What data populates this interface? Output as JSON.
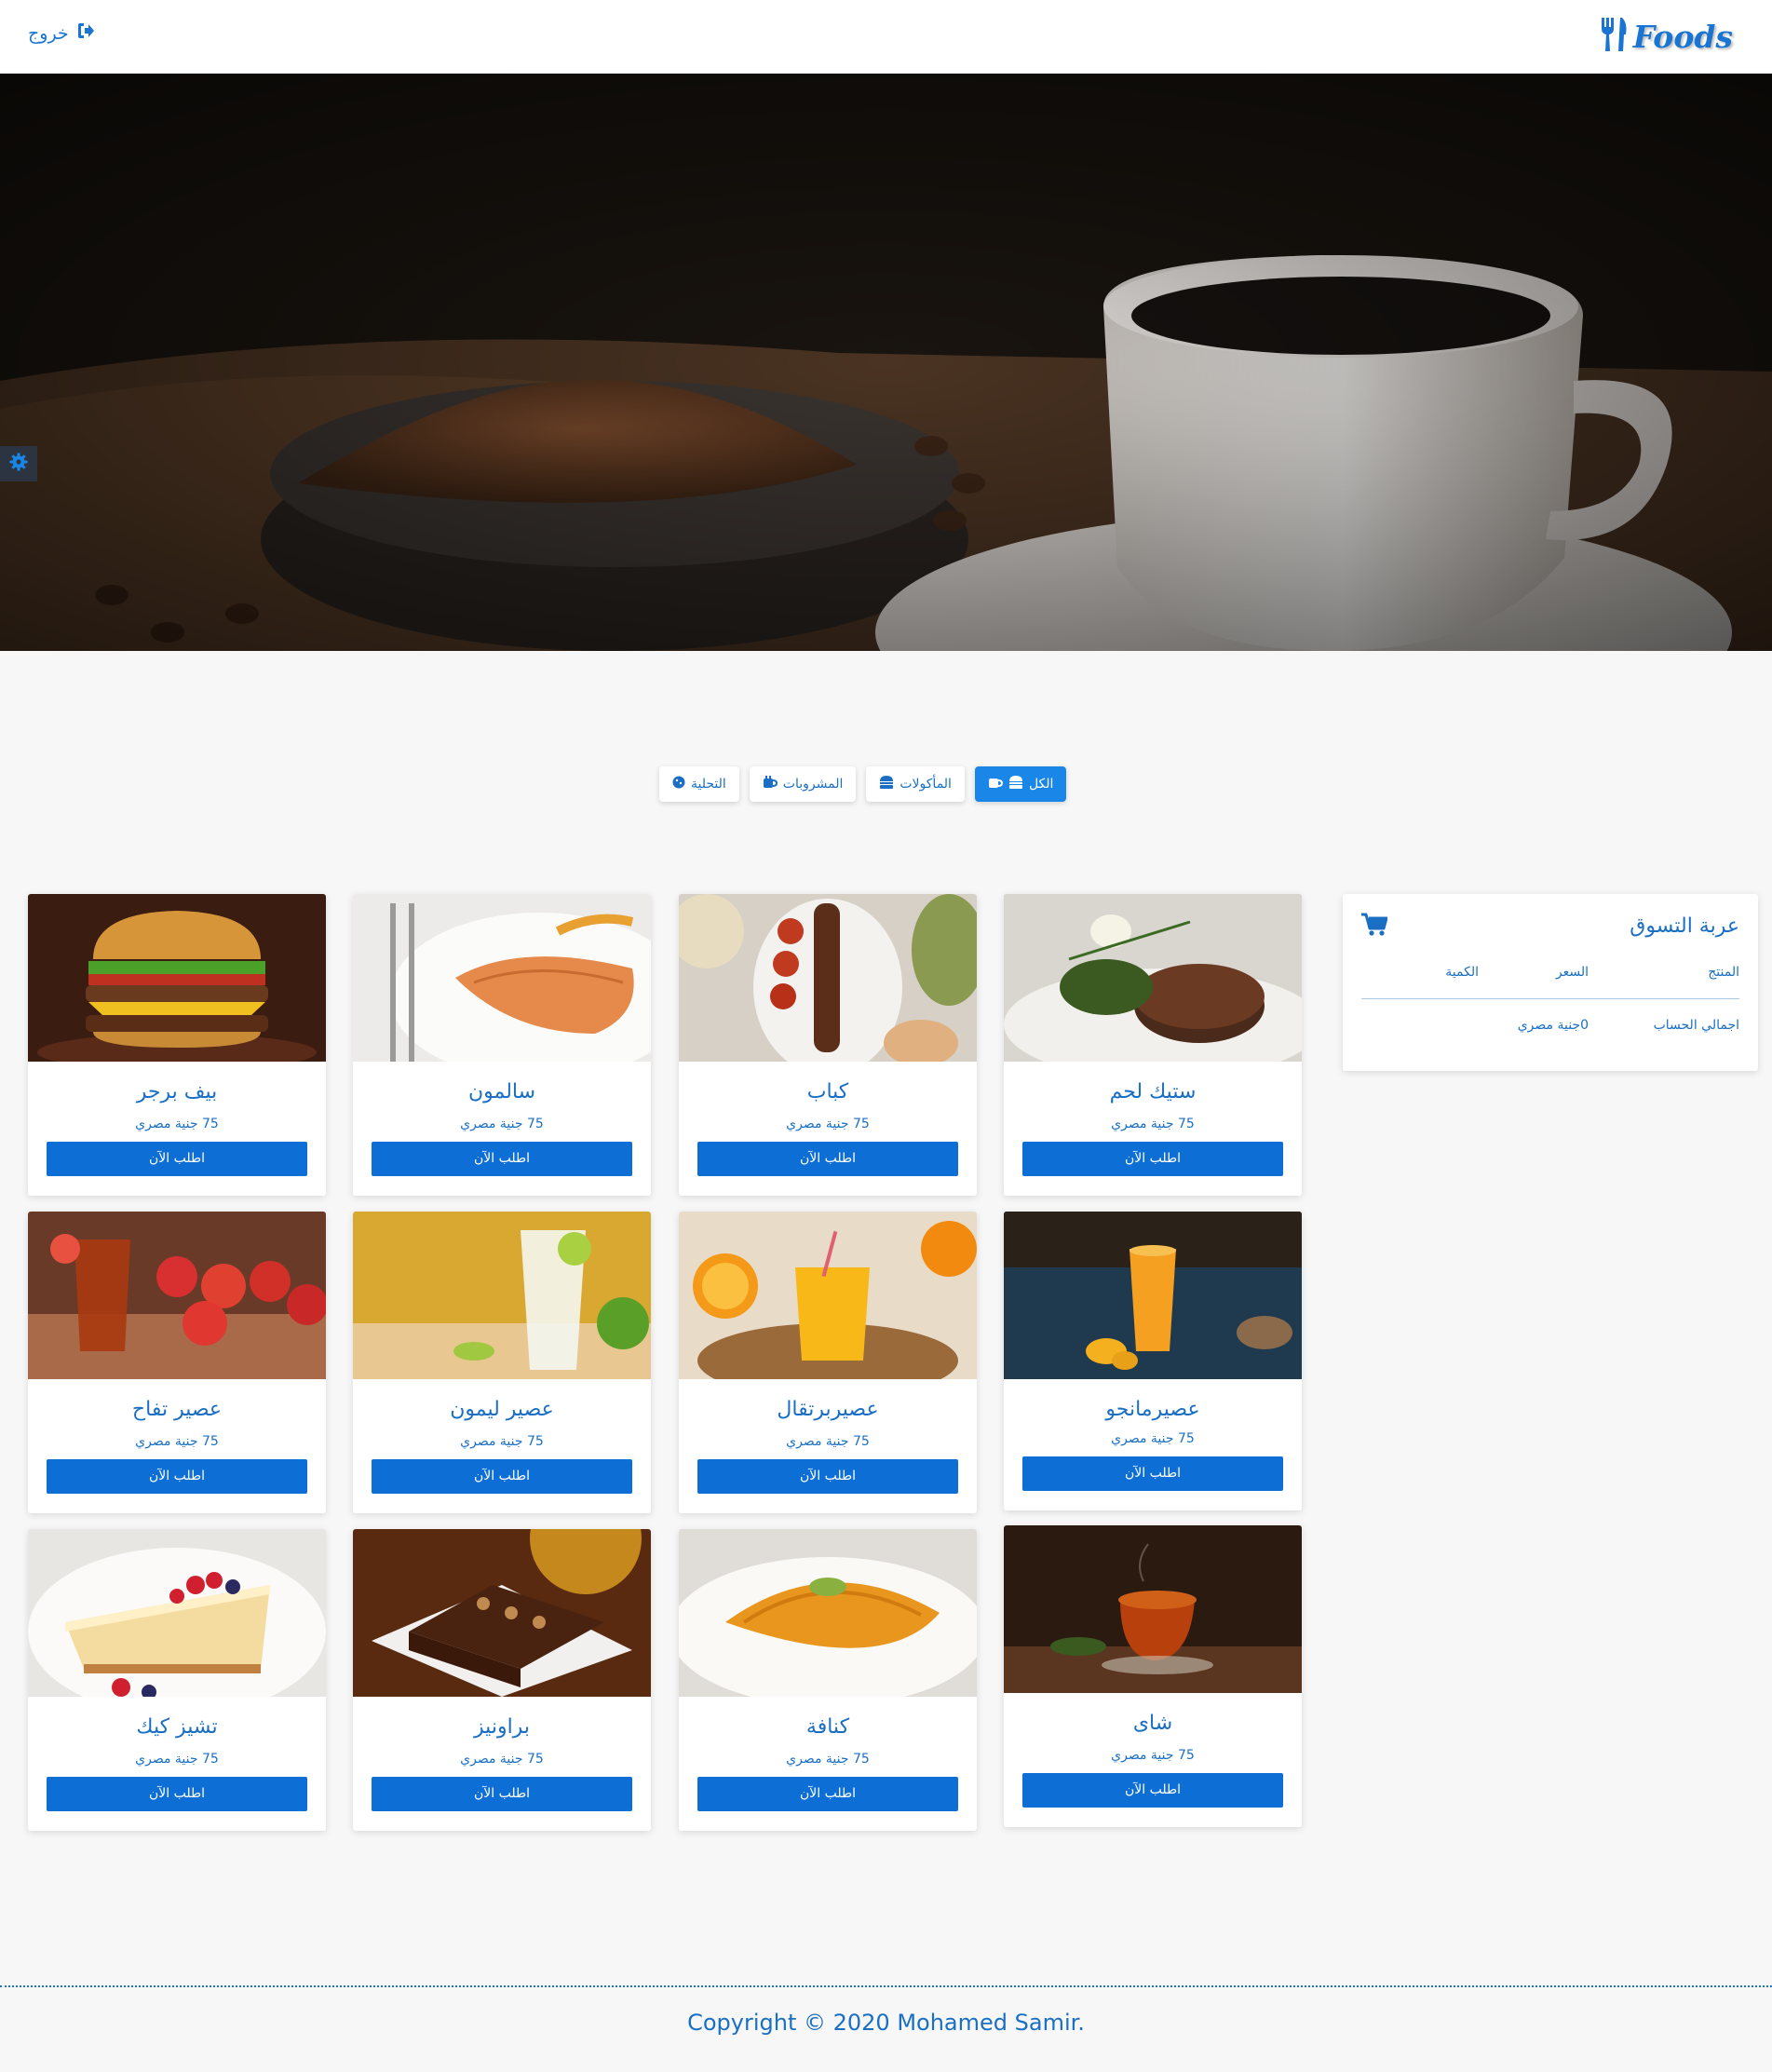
{
  "navbar": {
    "logo_text": "Foods",
    "logout_label": "خروج"
  },
  "filters": [
    {
      "label": "الكل",
      "active": true
    },
    {
      "label": "المأكولات",
      "active": false
    },
    {
      "label": "المشروبات",
      "active": false
    },
    {
      "label": "التحلية",
      "active": false
    }
  ],
  "cart": {
    "title": "عربة التسوق",
    "col_product": "المنتج",
    "col_price": "السعر",
    "col_qty": "الكمية",
    "total_label": "اجمالي الحساب",
    "total_value": "0جنية مصري"
  },
  "products": [
    {
      "name": "ستيك لحم",
      "price": "75 جنية مصري",
      "button": "اطلب الآن",
      "image": "steak"
    },
    {
      "name": "كباب",
      "price": "75 جنية مصري",
      "button": "اطلب الآن",
      "image": "kebab"
    },
    {
      "name": "سالمون",
      "price": "75 جنية مصري",
      "button": "اطلب الآن",
      "image": "salmon"
    },
    {
      "name": "بيف برجر",
      "price": "75 جنية مصري",
      "button": "اطلب الآن",
      "image": "burger"
    },
    {
      "name": "عصيرمانجو",
      "price": "75 جنية مصري",
      "button": "اطلب الآن",
      "image": "mango-juice"
    },
    {
      "name": "عصيربرتقال",
      "price": "75 جنية مصري",
      "button": "اطلب الآن",
      "image": "orange-juice"
    },
    {
      "name": "عصير ليمون",
      "price": "75 جنية مصري",
      "button": "اطلب الآن",
      "image": "lemon-juice"
    },
    {
      "name": "عصير تفاح",
      "price": "75 جنية مصري",
      "button": "اطلب الآن",
      "image": "apple-juice"
    },
    {
      "name": "شاى",
      "price": "75 جنية مصري",
      "button": "اطلب الآن",
      "image": "tea"
    },
    {
      "name": "كنافة",
      "price": "75 جنية مصري",
      "button": "اطلب الآن",
      "image": "kunafa"
    },
    {
      "name": "براونيز",
      "price": "75 جنية مصري",
      "button": "اطلب الآن",
      "image": "brownies"
    },
    {
      "name": "تشيز كيك",
      "price": "75 جنية مصري",
      "button": "اطلب الآن",
      "image": "cheesecake"
    }
  ],
  "footer": {
    "copyright": "Copyright © 2020 Mohamed Samir."
  }
}
